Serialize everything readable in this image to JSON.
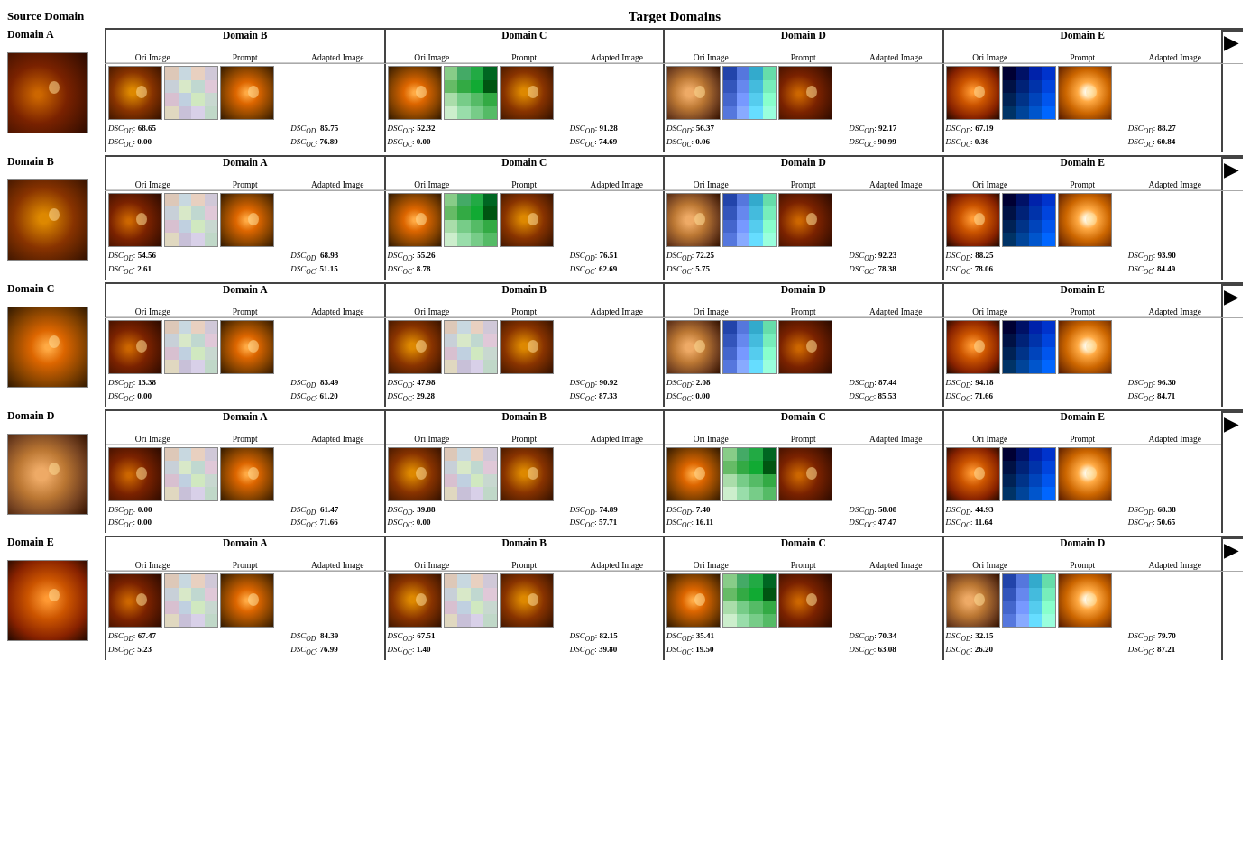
{
  "title": {
    "source": "Source Domain",
    "target": "Target Domains"
  },
  "columns": {
    "ori": "Ori Image",
    "prompt": "Prompt",
    "adapted": "Adapted Image"
  },
  "rows": [
    {
      "source_domain": "Domain A",
      "source_img_class": "ri-a",
      "targets": [
        {
          "name": "Domain B",
          "ori_class": "ri-b",
          "prompt_class": "pg-b1",
          "adapted_class": "ri-c",
          "dsc_od_src": "68.65",
          "dsc_oc_src": "0.00",
          "dsc_od_ada": "85.75",
          "dsc_oc_ada": "76.89"
        },
        {
          "name": "Domain C",
          "ori_class": "ri-c",
          "prompt_class": "pg-c1",
          "adapted_class": "ri-b",
          "dsc_od_src": "52.32",
          "dsc_oc_src": "0.00",
          "dsc_od_ada": "91.28",
          "dsc_oc_ada": "74.69"
        },
        {
          "name": "Domain D",
          "ori_class": "ri-d",
          "prompt_class": "pg-d1",
          "adapted_class": "ri-a",
          "dsc_od_src": "56.37",
          "dsc_oc_src": "0.06",
          "dsc_od_ada": "92.17",
          "dsc_oc_ada": "90.99"
        },
        {
          "name": "Domain E",
          "ori_class": "ri-e",
          "prompt_class": "pg-e1",
          "adapted_class": "ri-bright",
          "dsc_od_src": "67.19",
          "dsc_oc_src": "0.36",
          "dsc_od_ada": "88.27",
          "dsc_oc_ada": "60.84"
        }
      ]
    },
    {
      "source_domain": "Domain B",
      "source_img_class": "ri-b",
      "targets": [
        {
          "name": "Domain A",
          "ori_class": "ri-a",
          "prompt_class": "pg-b1",
          "adapted_class": "ri-c",
          "dsc_od_src": "54.56",
          "dsc_oc_src": "2.61",
          "dsc_od_ada": "68.93",
          "dsc_oc_ada": "51.15"
        },
        {
          "name": "Domain C",
          "ori_class": "ri-c",
          "prompt_class": "pg-c1",
          "adapted_class": "ri-b",
          "dsc_od_src": "55.26",
          "dsc_oc_src": "8.78",
          "dsc_od_ada": "76.51",
          "dsc_oc_ada": "62.69"
        },
        {
          "name": "Domain D",
          "ori_class": "ri-d",
          "prompt_class": "pg-d1",
          "adapted_class": "ri-a",
          "dsc_od_src": "72.25",
          "dsc_oc_src": "5.75",
          "dsc_od_ada": "92.23",
          "dsc_oc_ada": "78.38"
        },
        {
          "name": "Domain E",
          "ori_class": "ri-e",
          "prompt_class": "pg-e1",
          "adapted_class": "ri-bright",
          "dsc_od_src": "88.25",
          "dsc_oc_src": "78.06",
          "dsc_od_ada": "93.90",
          "dsc_oc_ada": "84.49"
        }
      ]
    },
    {
      "source_domain": "Domain C",
      "source_img_class": "ri-c",
      "targets": [
        {
          "name": "Domain A",
          "ori_class": "ri-a",
          "prompt_class": "pg-b1",
          "adapted_class": "ri-c",
          "dsc_od_src": "13.38",
          "dsc_oc_src": "0.00",
          "dsc_od_ada": "83.49",
          "dsc_oc_ada": "61.20"
        },
        {
          "name": "Domain B",
          "ori_class": "ri-b",
          "prompt_class": "pg-c1",
          "adapted_class": "ri-b",
          "dsc_od_src": "47.98",
          "dsc_oc_src": "29.28",
          "dsc_od_ada": "90.92",
          "dsc_oc_ada": "87.33"
        },
        {
          "name": "Domain D",
          "ori_class": "ri-d",
          "prompt_class": "pg-d1",
          "adapted_class": "ri-a",
          "dsc_od_src": "2.08",
          "dsc_oc_src": "0.00",
          "dsc_od_ada": "87.44",
          "dsc_oc_ada": "85.53"
        },
        {
          "name": "Domain E",
          "ori_class": "ri-e",
          "prompt_class": "pg-e1",
          "adapted_class": "ri-bright",
          "dsc_od_src": "94.18",
          "dsc_oc_src": "71.66",
          "dsc_od_ada": "96.30",
          "dsc_oc_ada": "84.71"
        }
      ]
    },
    {
      "source_domain": "Domain D",
      "source_img_class": "ri-d",
      "targets": [
        {
          "name": "Domain A",
          "ori_class": "ri-a",
          "prompt_class": "pg-b1",
          "adapted_class": "ri-c",
          "dsc_od_src": "0.00",
          "dsc_oc_src": "0.00",
          "dsc_od_ada": "61.47",
          "dsc_oc_ada": "71.66"
        },
        {
          "name": "Domain B",
          "ori_class": "ri-b",
          "prompt_class": "pg-c1",
          "adapted_class": "ri-b",
          "dsc_od_src": "39.88",
          "dsc_oc_src": "0.00",
          "dsc_od_ada": "74.89",
          "dsc_oc_ada": "57.71"
        },
        {
          "name": "Domain C",
          "ori_class": "ri-c",
          "prompt_class": "pg-d1",
          "adapted_class": "ri-a",
          "dsc_od_src": "7.40",
          "dsc_oc_src": "16.11",
          "dsc_od_ada": "58.08",
          "dsc_oc_ada": "47.47"
        },
        {
          "name": "Domain E",
          "ori_class": "ri-e",
          "prompt_class": "pg-e1",
          "adapted_class": "ri-bright",
          "dsc_od_src": "44.93",
          "dsc_oc_src": "11.64",
          "dsc_od_ada": "68.38",
          "dsc_oc_ada": "50.65"
        }
      ]
    },
    {
      "source_domain": "Domain E",
      "source_img_class": "ri-e",
      "targets": [
        {
          "name": "Domain A",
          "ori_class": "ri-a",
          "prompt_class": "pg-b1",
          "adapted_class": "ri-c",
          "dsc_od_src": "67.47",
          "dsc_oc_src": "5.23",
          "dsc_od_ada": "84.39",
          "dsc_oc_ada": "76.99"
        },
        {
          "name": "Domain B",
          "ori_class": "ri-b",
          "prompt_class": "pg-c1",
          "adapted_class": "ri-b",
          "dsc_od_src": "67.51",
          "dsc_oc_src": "1.40",
          "dsc_od_ada": "82.15",
          "dsc_oc_ada": "39.80"
        },
        {
          "name": "Domain C",
          "ori_class": "ri-c",
          "prompt_class": "pg-d1",
          "adapted_class": "ri-a",
          "dsc_od_src": "35.41",
          "dsc_oc_src": "19.50",
          "dsc_od_ada": "70.34",
          "dsc_oc_ada": "63.08"
        },
        {
          "name": "Domain D",
          "ori_class": "ri-d",
          "prompt_class": "pg-e1",
          "adapted_class": "ri-bright",
          "dsc_od_src": "32.15",
          "dsc_oc_src": "26.20",
          "dsc_od_ada": "79.70",
          "dsc_oc_ada": "87.21"
        }
      ]
    }
  ],
  "labels": {
    "ori": "Ori Image",
    "prompt": "Prompt",
    "adapted": "Adapted Image",
    "dsc_od": "DSC",
    "dsc_oc": "DSC"
  }
}
